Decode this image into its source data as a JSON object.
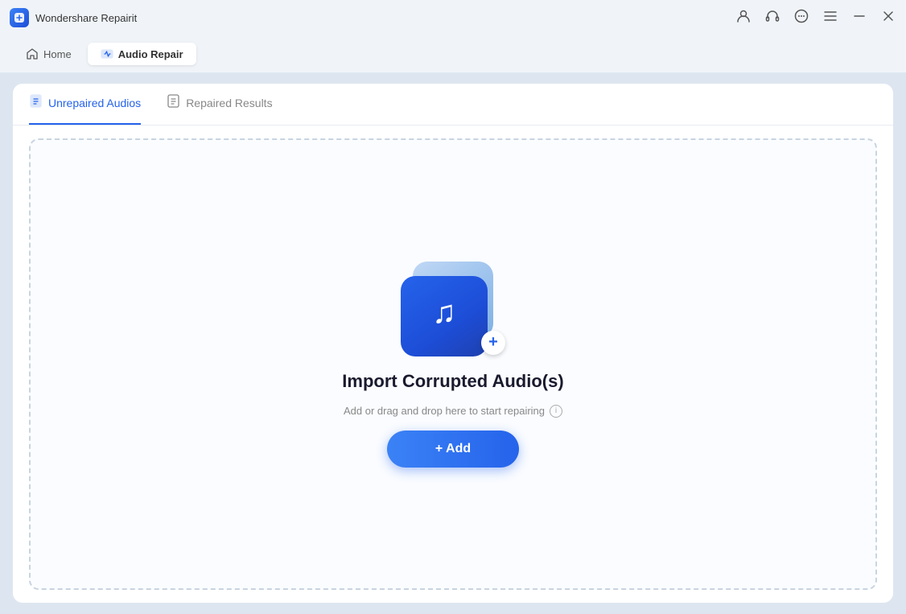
{
  "titleBar": {
    "appName": "Wondershare Repairit",
    "icons": [
      "person",
      "headphones",
      "chat",
      "menu",
      "minimize",
      "close"
    ]
  },
  "navBar": {
    "homeLabel": "Home",
    "activeSection": "Audio Repair"
  },
  "tabs": [
    {
      "id": "unrepaired",
      "label": "Unrepaired Audios",
      "active": true
    },
    {
      "id": "repaired",
      "label": "Repaired Results",
      "active": false
    }
  ],
  "dropZone": {
    "title": "Import Corrupted Audio(s)",
    "subtitle": "Add or drag and drop here to start repairing",
    "addButtonLabel": "+ Add"
  }
}
